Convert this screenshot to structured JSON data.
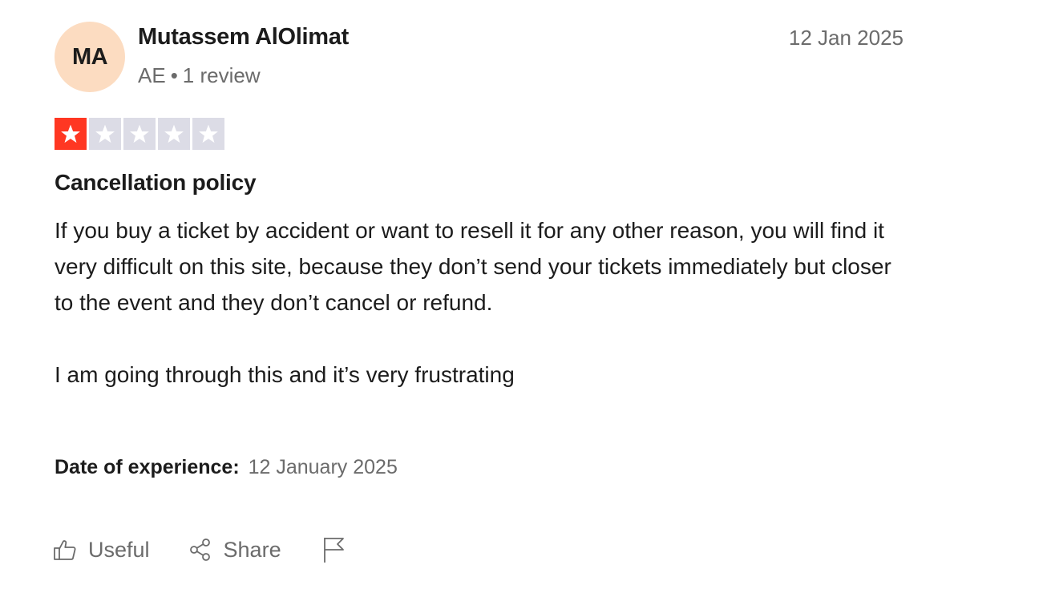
{
  "reviewer": {
    "initials": "MA",
    "name": "Mutassem AlOlimat",
    "country": "AE",
    "separator": "•",
    "review_count": "1 review"
  },
  "review": {
    "date": "12 Jan 2025",
    "rating": 1,
    "rating_max": 5,
    "title": "Cancellation policy",
    "paragraphs": [
      "If you buy a ticket by accident or want to resell it for any other reason, you will find it very difficult on this site, because they don’t send your tickets immediately but closer to the event and they don’t cancel or refund.",
      "I am going through this and it’s very frustrating"
    ],
    "experience_label": "Date of experience:",
    "experience_date": "12 January 2025"
  },
  "actions": {
    "useful_label": "Useful",
    "share_label": "Share"
  },
  "colors": {
    "star_filled": "#ff3722",
    "star_empty": "#dcdce6",
    "avatar_bg": "#fcdcc1",
    "muted_text": "#6b6b6b"
  },
  "icons": {
    "useful": "thumbs-up-icon",
    "share": "share-icon",
    "report": "flag-icon",
    "star": "star-icon"
  }
}
